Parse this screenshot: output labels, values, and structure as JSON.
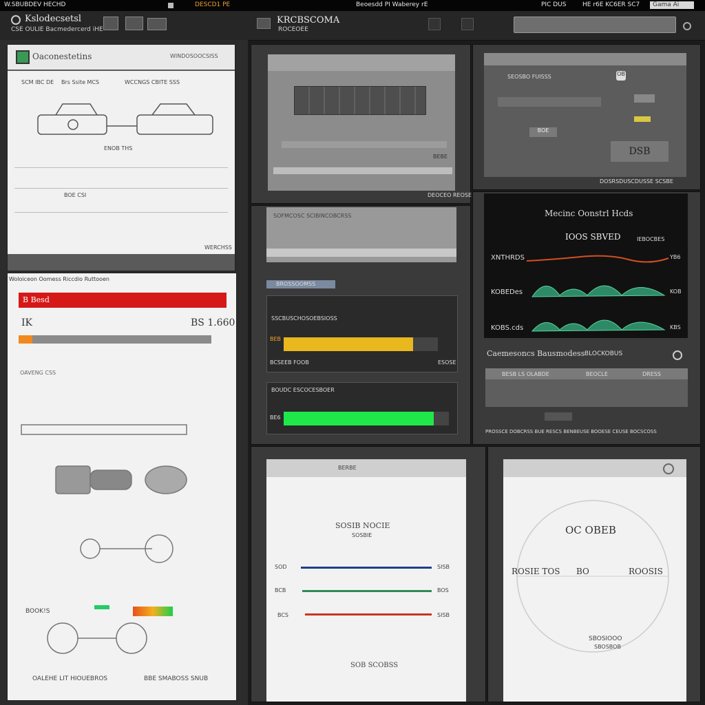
{
  "topbar": {
    "left_text": "W.SBUBDEV HECHD",
    "center_text": "DESCD1 PE",
    "center2_text": "Beoesdd PI Waberey rE",
    "right1_text": "PIC DUS",
    "right2_text": "HE r6E KC6ER SC7",
    "right_field": "Gama Ai"
  },
  "header": {
    "app_title": "Kslodecsetsl",
    "app_subtitle": "CSE OULIE  Bacmedercerd iHE",
    "center_title": "KRCBSCOMA",
    "center_subtitle": "ROCEOEE"
  },
  "left_top": {
    "title": "Oaconestetins",
    "header_right": "WINDOSOOCSISS",
    "row_labels": [
      "SCM IBC DE",
      "Brs Ssite MCS",
      "WCCNGS CBITE SSS"
    ],
    "center_label": "ENOB THS",
    "footer_left": "BOE CSI",
    "footer_right": "WERCHSS"
  },
  "left_bottom": {
    "header": "Woloiceon Oomess Riccdio Ruttooen",
    "red_label": "B Besd",
    "left_value": "IK",
    "right_value": "BS 1.660",
    "orange_progress": 0.07,
    "mid_label": "OAVENG CSS",
    "bottom_left_label": "BOOK!S",
    "footer_left": "OALEHE LIT HIOUEBROS",
    "footer_right": "BBE SMABOSS SNUB"
  },
  "mid_top": {
    "bottom_bar_text": "DEOCEO REOSE",
    "corner_text": "BEBE"
  },
  "mid_bars": {
    "panel_header": "SOFMCOSC SCIBINCOBCRSS",
    "yellow_title": "SSCBUSCHOSOEBSIOSS",
    "yellow_label": "BEB",
    "yellow_foot_left": "BCSEEB FOOB",
    "yellow_foot_right": "ESOSE",
    "yellow_progress": 0.84,
    "green_title": "BOUDC ESCOCESBOER",
    "green_label": "BE6",
    "green_progress": 0.91,
    "blue_button": "BROSSOOMSS"
  },
  "right_top": {
    "title": "SEOSBO FUISSS",
    "badge": "OB",
    "button_text": "BOE",
    "big_value": "DSB",
    "footer_text": "DOSRSDUSCDUSSE SCSBE"
  },
  "chart_panel": {
    "title": "Mecinc Oonstrl Hcds",
    "value_label": "IOOS SBVED",
    "value_right": "IEBOCBES",
    "rows": [
      {
        "label": "XNTHRDS",
        "right": "YB6"
      },
      {
        "label": "KOBEDes",
        "right": "KOB"
      },
      {
        "label": "KOBS.cds",
        "right": "KBS"
      }
    ]
  },
  "right_table": {
    "title": "Caemesoncs Bausmodess",
    "title_right": "BLOCKOBUS",
    "headers": [
      "BESB LS OLABDE",
      "BEOCLE",
      "DRESS"
    ],
    "footer": "PROSSCE DOBCRSS BUE RESCS  BENBEUSE BOOESE CEUSE BOCSCOSS"
  },
  "bottom_mid": {
    "header": "BERBE",
    "title": "SOSIB NOCIE",
    "subtitle": "SOSBIE",
    "lines": [
      {
        "label": "SOD",
        "right": "SISB",
        "color": "#1f3f8a"
      },
      {
        "label": "BCB",
        "right": "BOS",
        "color": "#2e8a58"
      },
      {
        "label": "BCS",
        "right": "SISB",
        "color": "#cc3322"
      }
    ],
    "footer": "SOB SCOBSS"
  },
  "bottom_right": {
    "title": "OC OBEB",
    "left_label": "ROSIE TOS",
    "center_label": "BO",
    "right_label": "ROOSIS",
    "footer": "SBOSIOOO",
    "footer2": "SBOSBOB"
  }
}
